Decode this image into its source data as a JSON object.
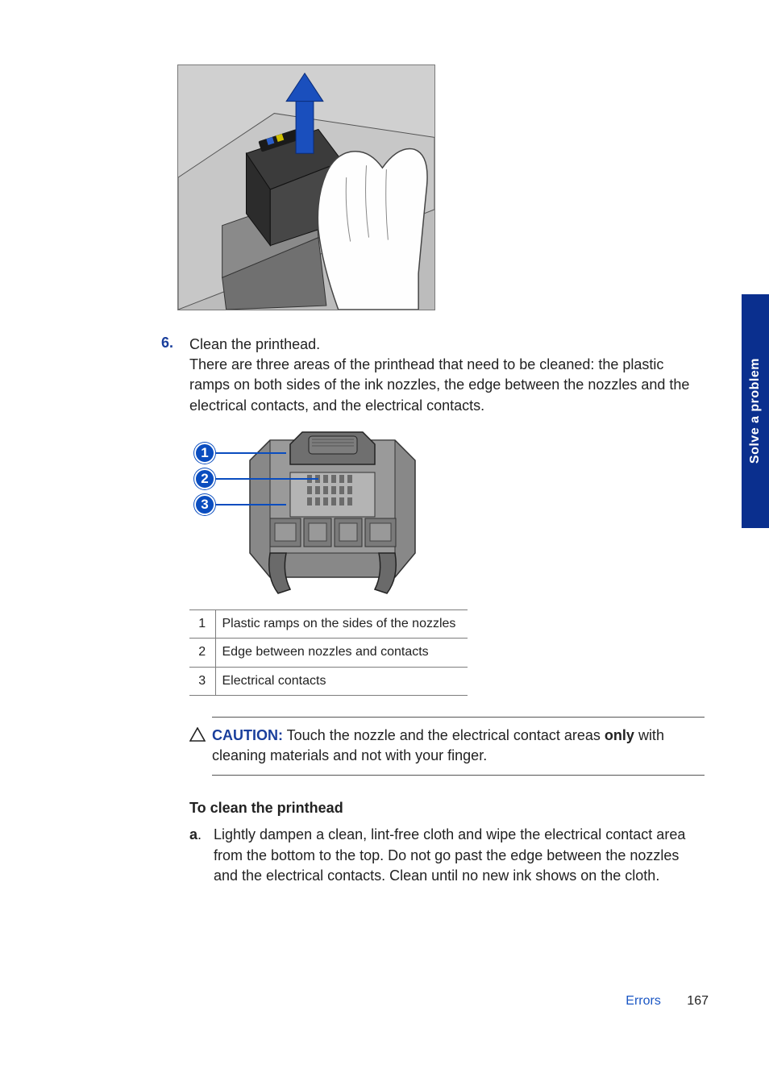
{
  "sideTab": "Solve a problem",
  "step": {
    "num": "6.",
    "line1": "Clean the printhead.",
    "para": "There are three areas of the printhead that need to be cleaned: the plastic ramps on both sides of the ink nozzles, the edge between the nozzles and the electrical contacts, and the electrical contacts."
  },
  "callouts": {
    "c1": "1",
    "c2": "2",
    "c3": "3"
  },
  "legend": [
    {
      "n": "1",
      "t": "Plastic ramps on the sides of the nozzles"
    },
    {
      "n": "2",
      "t": "Edge between nozzles and contacts"
    },
    {
      "n": "3",
      "t": "Electrical contacts"
    }
  ],
  "caution": {
    "label": "CAUTION:",
    "pre": "  Touch the nozzle and the electrical contact areas ",
    "bold": "only",
    "post": " with cleaning materials and not with your finger."
  },
  "subhead": "To clean the printhead",
  "substep": {
    "lbl": "a",
    "dot": ".",
    "text": "Lightly dampen a clean, lint-free cloth and wipe the electrical contact area from the bottom to the top. Do not go past the edge between the nozzles and the electrical contacts. Clean until no new ink shows on the cloth."
  },
  "footer": {
    "section": "Errors",
    "page": "167"
  }
}
